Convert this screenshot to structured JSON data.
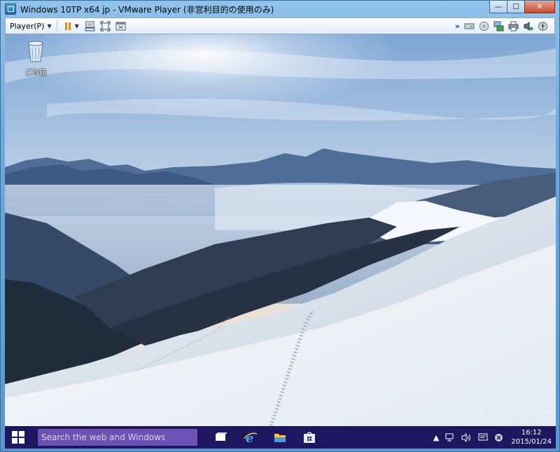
{
  "window": {
    "title": "Windows 10TP x64 jp - VMware Player (非営利目的の使用のみ)",
    "minimize_glyph": "—",
    "maximize_glyph": "☐",
    "close_glyph": "✕"
  },
  "toolbar": {
    "player_menu": "Player(P)",
    "icons": [
      "pause-icon",
      "send-ctrl-alt-del-icon",
      "fit-window-icon",
      "unity-icon"
    ],
    "device_icons": [
      "hard-disk-icon",
      "cd-dvd-icon",
      "network-adapter-icon",
      "printer-icon",
      "sound-card-icon",
      "usb-device-icon"
    ]
  },
  "desktop": {
    "recycle_bin_label": "ごみ箱",
    "watermark_line1": "Windows 10 Pro Technical Preview",
    "watermark_line2": "評価コピー。Build 9926"
  },
  "taskbar": {
    "search_placeholder": "Search the web and Windows",
    "clock_time": "16:12",
    "clock_date": "2015/01/24",
    "accent_color": "#1f1660",
    "search_color": "#6c52b4"
  }
}
